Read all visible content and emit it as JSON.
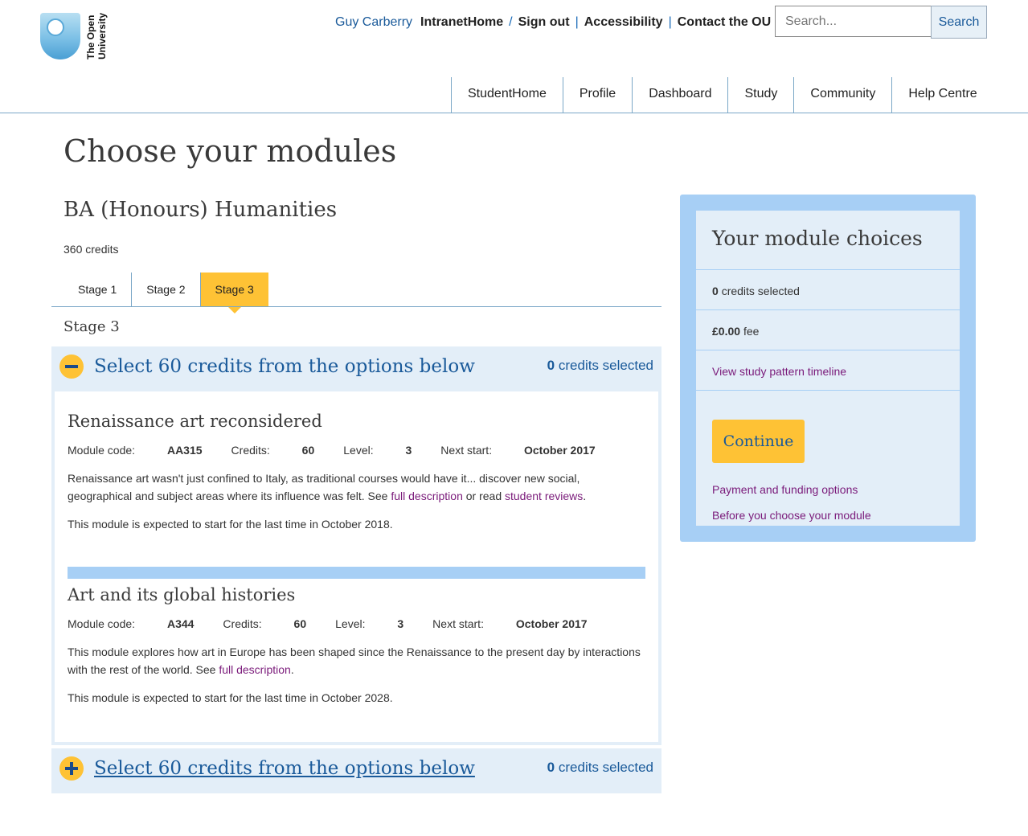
{
  "logo": {
    "text_line1": "The Open",
    "text_line2": "University"
  },
  "header": {
    "user_name": "Guy Carberry",
    "links": [
      "IntranetHome",
      "Sign out",
      "Accessibility",
      "Contact the OU"
    ],
    "search": {
      "placeholder": "Search...",
      "button_label": "Search"
    }
  },
  "nav": {
    "items": [
      "StudentHome",
      "Profile",
      "Dashboard",
      "Study",
      "Community",
      "Help Centre"
    ]
  },
  "page": {
    "title": "Choose your modules",
    "course_title": "BA (Honours) Humanities",
    "total_credits": "360 credits",
    "tabs": [
      {
        "label": "Stage 1",
        "active": false
      },
      {
        "label": "Stage 2",
        "active": false
      },
      {
        "label": "Stage 3",
        "active": true
      }
    ],
    "stage_label": "Stage 3"
  },
  "groups": [
    {
      "title": "Select 60 credits from the options below",
      "count": "0",
      "count_suffix": "credits selected",
      "expanded": true
    },
    {
      "title": "Select 60 credits from the options below",
      "count": "0",
      "count_suffix": "credits selected",
      "expanded": false
    }
  ],
  "modules": [
    {
      "name": "Renaissance art reconsidered",
      "code_label": "Module code:",
      "code": "AA315",
      "credits_label": "Credits:",
      "credits": "60",
      "level_label": "Level:",
      "level": "3",
      "start_label": "Next start:",
      "start": "October 2017",
      "desc_text": "Renaissance art wasn't just confined to Italy, as traditional courses would have it... discover new social, geographical and subject areas where its influence was felt. See ",
      "desc_link1": "full description",
      "desc_mid": " or read ",
      "desc_link2": "student reviews",
      "desc_end": ".",
      "note": "This module is expected to start for the last time in October 2018."
    },
    {
      "name": "Art and its global histories",
      "code_label": "Module code:",
      "code": "A344",
      "credits_label": "Credits:",
      "credits": "60",
      "level_label": "Level:",
      "level": "3",
      "start_label": "Next start:",
      "start": "October 2017",
      "desc_text": "This module explores how art in Europe has been shaped since the Renaissance to the present day by interactions with the rest of the world. See ",
      "desc_link1": "full description",
      "desc_end": ".",
      "note": "This module is expected to start for the last time in October 2028."
    }
  ],
  "sidebar": {
    "title": "Your module choices",
    "credits_value": "0",
    "credits_suffix": "credits selected",
    "fee_value": "£0.00",
    "fee_suffix": "fee",
    "timeline_link": "View study pattern timeline",
    "continue_label": "Continue",
    "payment_link": "Payment and funding options",
    "before_link": "Before you choose your module"
  },
  "colors": {
    "accent_yellow": "#fec235",
    "link_blue": "#1a5a9a",
    "visited_purple": "#7a1a7a",
    "panel_light": "#e3eef8",
    "panel_border": "#a7cff5"
  },
  "icons": {
    "logo": "open-university-shield-icon",
    "collapse": "minus-circle-icon",
    "expand": "plus-circle-icon"
  }
}
